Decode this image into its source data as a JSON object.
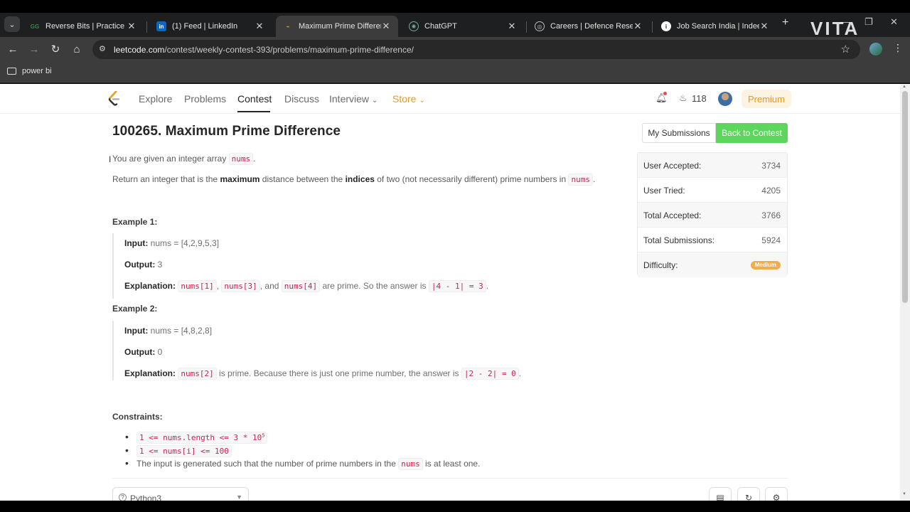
{
  "browser": {
    "tabs": [
      {
        "title": "Reverse Bits | Practice | Geeks",
        "favicon": "gfg-icon"
      },
      {
        "title": "(1) Feed | LinkedIn",
        "favicon": "linkedin-icon"
      },
      {
        "title": "Maximum Prime Difference - LeetCode",
        "favicon": "leetcode-icon",
        "active": true
      },
      {
        "title": "ChatGPT",
        "favicon": "chatgpt-icon"
      },
      {
        "title": "Careers | Defence Research",
        "favicon": "globe-icon"
      },
      {
        "title": "Job Search India | Indeed",
        "favicon": "info-icon"
      }
    ],
    "url_host": "leetcode.com",
    "url_path": "/contest/weekly-contest-393/problems/maximum-prime-difference/",
    "bookmark": "power bi",
    "watermark": "VITA"
  },
  "nav": {
    "items": [
      "Explore",
      "Problems",
      "Contest",
      "Discuss",
      "Interview",
      "Store"
    ],
    "active": "Contest",
    "streak": "118",
    "premium": "Premium"
  },
  "problem": {
    "title": "100265. Maximum Prime Difference",
    "intro_pre": "You are given an integer array ",
    "intro_code": "nums",
    "intro_post": ".",
    "desc_1": "Return an integer that is the ",
    "desc_bold_1": "maximum",
    "desc_2": " distance between the ",
    "desc_bold_2": "indices",
    "desc_3": " of two (not necessarily different) prime numbers in ",
    "desc_code": "nums",
    "desc_4": "."
  },
  "examples": [
    {
      "heading": "Example 1:",
      "input_label": "Input:",
      "input": "nums = [4,2,9,5,3]",
      "output_label": "Output:",
      "output": "3",
      "expl_label": "Explanation:",
      "expl_c1": "nums[1]",
      "expl_t1": ", ",
      "expl_c2": "nums[3]",
      "expl_t2": ", and ",
      "expl_c3": "nums[4]",
      "expl_t3": " are prime. So the answer is ",
      "expl_c4": "|4 - 1| = 3",
      "expl_t4": "."
    },
    {
      "heading": "Example 2:",
      "input_label": "Input:",
      "input": "nums = [4,8,2,8]",
      "output_label": "Output:",
      "output": "0",
      "expl_label": "Explanation:",
      "expl_c1": "nums[2]",
      "expl_t1": " is prime. Because there is just one prime number, the answer is ",
      "expl_c2": "|2 - 2| = 0",
      "expl_t2": "."
    }
  ],
  "constraints": {
    "heading": "Constraints:",
    "c1": "1 <= nums.length <= 3 * 10",
    "c1_sup": "5",
    "c2": "1 <= nums[i] <= 100",
    "c3_pre": "The input is generated such that the number of prime numbers in the ",
    "c3_code": "nums",
    "c3_post": " is at least one."
  },
  "editor": {
    "language": "Python3"
  },
  "side": {
    "my_submissions": "My Submissions",
    "back_to_contest": "Back to Contest",
    "stats": [
      {
        "label": "User Accepted:",
        "value": "3734"
      },
      {
        "label": "User Tried:",
        "value": "4205"
      },
      {
        "label": "Total Accepted:",
        "value": "3766"
      },
      {
        "label": "Total Submissions:",
        "value": "5924"
      },
      {
        "label": "Difficulty:",
        "value": "Medium"
      }
    ]
  },
  "colors": {
    "accent_green": "#5cd65c",
    "store_orange": "#e89a1c",
    "difficulty_medium": "#f0ad4e"
  }
}
